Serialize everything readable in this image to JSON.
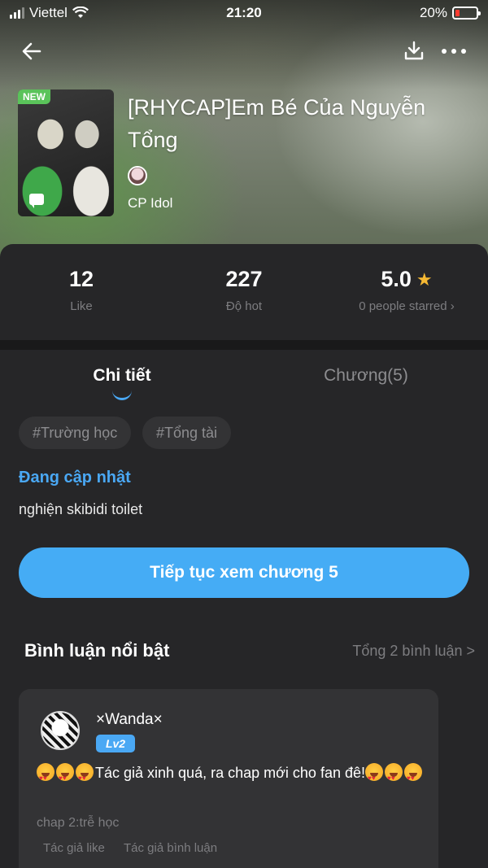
{
  "status_bar": {
    "carrier": "Viettel",
    "time": "21:20",
    "battery": "20%",
    "battery_level": 0.2
  },
  "topbar": {
    "back_icon": "back-arrow-icon",
    "download_icon": "download-icon",
    "more_icon": "more-dots-icon"
  },
  "story": {
    "badge": "NEW",
    "title": "[RHYCAP]Em Bé Của Nguyễn Tổng",
    "category": "CP Idol"
  },
  "stats": {
    "likes": {
      "value": "12",
      "label": "Like"
    },
    "hot": {
      "value": "227",
      "label": "Độ hot"
    },
    "rating": {
      "value": "5.0",
      "label": "0 people starred  ›"
    }
  },
  "tabs": [
    {
      "label": "Chi tiết",
      "active": true
    },
    {
      "label": "Chương(5)",
      "active": false
    }
  ],
  "tags": [
    "#Trường học",
    "#Tổng tài"
  ],
  "status_label": "Đang cập nhật",
  "description": "nghiện skibidi toilet",
  "continue_button": "Tiếp tục xem chương 5",
  "comments_section": {
    "title": "Bình luận nổi bật",
    "total_link": "Tổng 2 bình luận >"
  },
  "comment": {
    "username": "×Wanda×",
    "level": "Lv2",
    "text": "Tác giả xinh quá, ra chap mới cho fan đê!",
    "chapter": "chap 2:trễ học",
    "author_liked": "Tác giả like",
    "author_replied": "Tác giả bình luận"
  },
  "colors": {
    "accent": "#45acf5",
    "background": "#262628",
    "new_badge": "#5ac35a",
    "star": "#f5b833"
  }
}
